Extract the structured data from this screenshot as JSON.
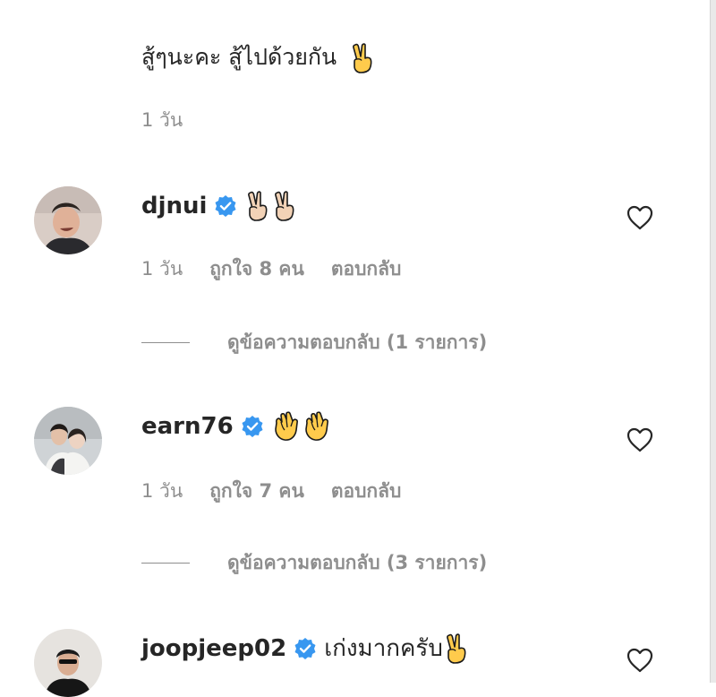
{
  "caption": {
    "text": "สู้ๆนะคะ สู้ไปด้วยกัน",
    "emoji": "victory-hand",
    "time": "1 วัน"
  },
  "comments": [
    {
      "username": "djnui",
      "verified": true,
      "text": "",
      "emoji": "victory-hand-light ×2",
      "time": "1 วัน",
      "likes": "ถูกใจ 8 คน",
      "reply_label": "ตอบกลับ",
      "view_replies": "ดูข้อความตอบกลับ (1 รายการ)"
    },
    {
      "username": "earn76",
      "verified": true,
      "text": "",
      "emoji": "clapping-hands ×2",
      "time": "1 วัน",
      "likes": "ถูกใจ 7 คน",
      "reply_label": "ตอบกลับ",
      "view_replies": "ดูข้อความตอบกลับ (3 รายการ)"
    },
    {
      "username": "joopjeep02",
      "verified": true,
      "text": "เก่งมากครับ",
      "emoji": "victory-hand"
    }
  ],
  "colors": {
    "text": "#262626",
    "secondary": "#8e8e8e",
    "verified_blue": "#3897f0",
    "emoji_yellow": "#ffcb4c"
  }
}
